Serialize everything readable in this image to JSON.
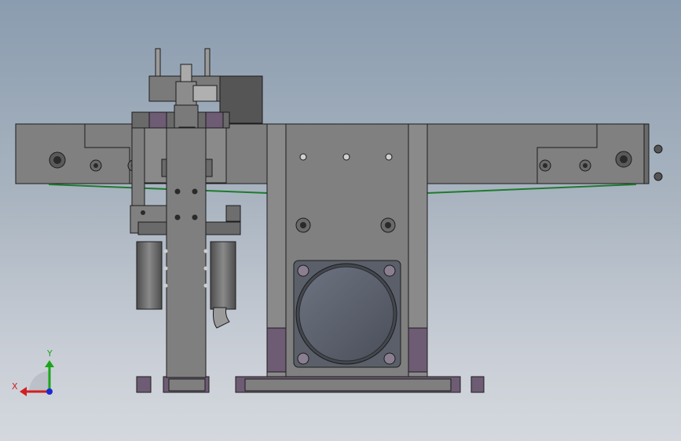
{
  "viewport": {
    "background_top": "#8a9caf",
    "background_bottom": "#d4d8de"
  },
  "model": {
    "body_color": "#7f7f7f",
    "body_dark": "#595959",
    "outline_color": "#1c1c1c",
    "accent_purple": "#6e5b74",
    "belt_color": "#1f7a2e"
  },
  "triad": {
    "x_label": "X",
    "y_label": "Y",
    "x_color": "#d02020",
    "y_color": "#1aa51a",
    "z_color": "#1a2ad0"
  }
}
